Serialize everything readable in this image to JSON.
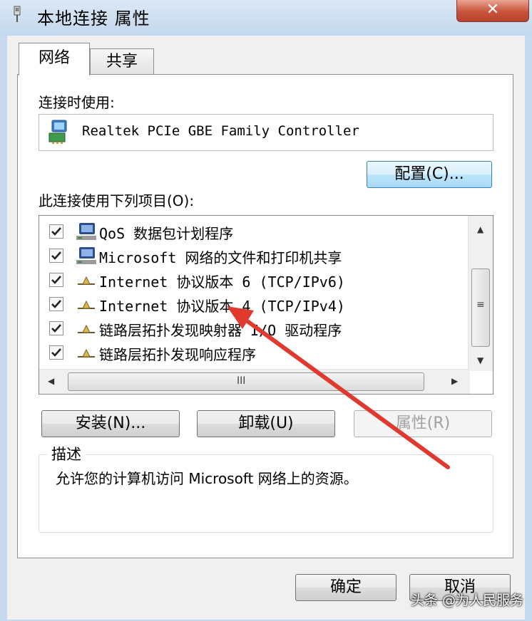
{
  "window": {
    "title": "本地连接 属性",
    "close_label": "✕"
  },
  "tabs": [
    {
      "label": "网络",
      "active": true
    },
    {
      "label": "共享",
      "active": false
    }
  ],
  "connect_using": {
    "label": "连接时使用:",
    "adapter": "Realtek PCIe GBE Family Controller",
    "configure_button": "配置(C)..."
  },
  "items_section": {
    "label": "此连接使用下列项目(O):",
    "items": [
      {
        "label": "QoS 数据包计划程序",
        "checked": true,
        "icon": "network-computer-icon"
      },
      {
        "label": "Microsoft 网络的文件和打印机共享",
        "checked": true,
        "icon": "network-computer-icon"
      },
      {
        "label": "Internet 协议版本 6 (TCP/IPv6)",
        "checked": true,
        "icon": "protocol-icon"
      },
      {
        "label": "Internet 协议版本 4 (TCP/IPv4)",
        "checked": true,
        "icon": "protocol-icon"
      },
      {
        "label": "链路层拓扑发现映射器 I/O 驱动程序",
        "checked": true,
        "icon": "protocol-icon"
      },
      {
        "label": "链路层拓扑发现响应程序",
        "checked": true,
        "icon": "protocol-icon"
      }
    ],
    "hscroll_grip": "III",
    "vscroll_grip": "≡"
  },
  "buttons": {
    "install": "安装(N)...",
    "uninstall": "卸载(U)",
    "properties": "属性(R)"
  },
  "description": {
    "title": "描述",
    "text": "允许您的计算机访问 Microsoft 网络上的资源。"
  },
  "footer": {
    "ok": "确定",
    "cancel": "取消"
  },
  "watermark": "头条 @为人民服务",
  "colors": {
    "annotation_arrow": "#e03a2f",
    "config_button_accent": "#3c7fb1"
  }
}
